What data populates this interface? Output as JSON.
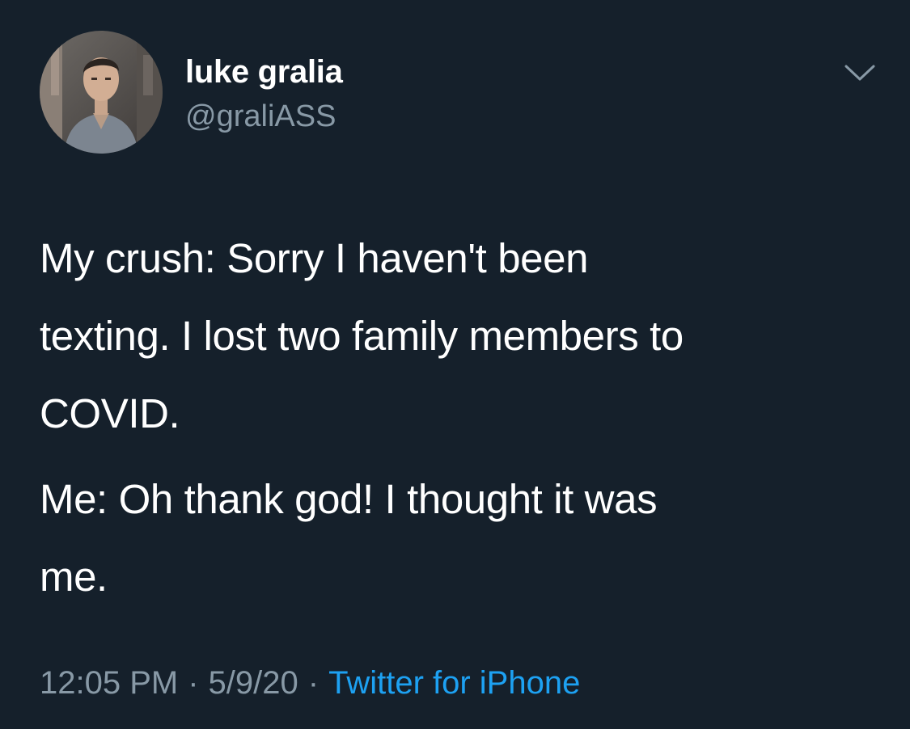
{
  "author": {
    "display_name": "luke gralia",
    "handle": "@graliASS",
    "avatar_icon": "profile-photo"
  },
  "tweet": {
    "paragraphs": [
      "My crush: Sorry I haven't been\ntexting. I lost two family members to\nCOVID.",
      "Me: Oh thank god! I thought it was\nme."
    ]
  },
  "meta": {
    "time": "12:05 PM",
    "separator": "·",
    "date": "5/9/20",
    "source": "Twitter for iPhone"
  },
  "menu": {
    "icon": "chevron-down-icon"
  },
  "colors": {
    "background": "#15202b",
    "primary_text": "#ffffff",
    "secondary_text": "#8899a6",
    "link": "#1da1f2"
  }
}
